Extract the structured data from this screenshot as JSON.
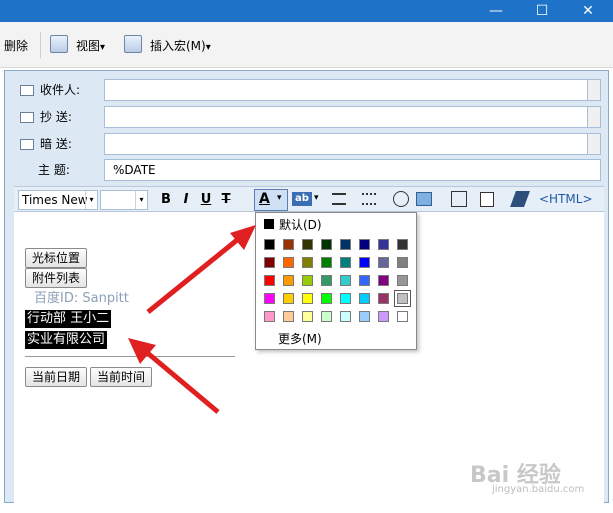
{
  "window": {
    "minimize_glyph": "—",
    "maximize_glyph": "☐",
    "close_glyph": "✕"
  },
  "toolbar": {
    "delete_label": "删除",
    "view_label": "视图",
    "insert_macro_label": "插入宏(M)",
    "dropdown_glyph": "▾"
  },
  "headers": {
    "to_label": "收件人:",
    "cc_label": "抄  送:",
    "bcc_label": "暗  送:",
    "subject_label": "主  题:",
    "subject_value": "%DATE"
  },
  "format_bar": {
    "font_name": "Times New",
    "font_size": "",
    "bold": "B",
    "italic": "I",
    "underline": "U",
    "strike": "T",
    "font_color": "A",
    "highlight": "ab",
    "html_label": "<HTML>"
  },
  "editor": {
    "cursor_pos_btn": "光标位置",
    "attach_list_btn": "附件列表",
    "watermark_text": "百度ID: Sanpitt",
    "selected_line1": "行动部   王小二",
    "selected_line2": "实业有限公司",
    "current_date_btn": "当前日期",
    "current_time_btn": "当前时间"
  },
  "color_popup": {
    "default_label": "默认(D)",
    "more_label": "更多(M)",
    "default_color": "#000000",
    "rows": [
      [
        "#000000",
        "#993300",
        "#333300",
        "#003300",
        "#003366",
        "#000080",
        "#333399",
        "#333333"
      ],
      [
        "#800000",
        "#ff6600",
        "#808000",
        "#008000",
        "#008080",
        "#0000ff",
        "#666699",
        "#808080"
      ],
      [
        "#ff0000",
        "#ff9900",
        "#99cc00",
        "#339966",
        "#33cccc",
        "#3366ff",
        "#800080",
        "#969696"
      ],
      [
        "#ff00ff",
        "#ffcc00",
        "#ffff00",
        "#00ff00",
        "#00ffff",
        "#00ccff",
        "#993366",
        "#c0c0c0"
      ],
      [
        "#ff99cc",
        "#ffcc99",
        "#ffff99",
        "#ccffcc",
        "#ccffff",
        "#99ccff",
        "#cc99ff",
        "#ffffff"
      ]
    ]
  },
  "watermark": {
    "brand": "Bai 经验",
    "url": "jingyan.baidu.com"
  },
  "colors": {
    "accent": "#1e73c9",
    "arrow": "#e02020"
  }
}
